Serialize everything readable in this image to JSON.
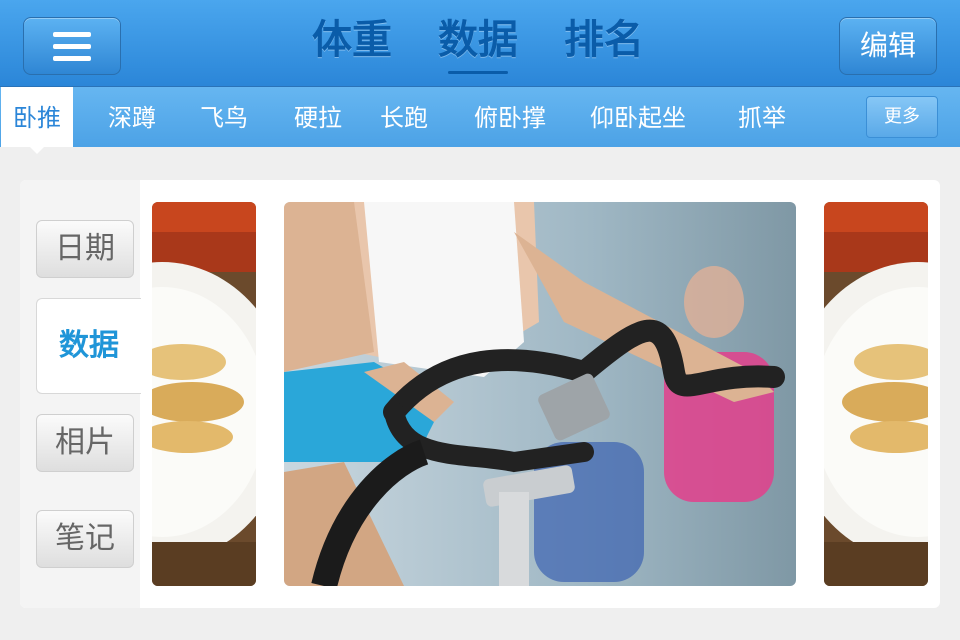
{
  "header": {
    "tabs": [
      {
        "label": "体重"
      },
      {
        "label": "数据"
      },
      {
        "label": "排名"
      }
    ],
    "active_tab_index": 1,
    "edit_label": "编辑"
  },
  "subtabs": {
    "items": [
      {
        "label": "卧推"
      },
      {
        "label": "深蹲"
      },
      {
        "label": "飞鸟"
      },
      {
        "label": "硬拉"
      },
      {
        "label": "长跑"
      },
      {
        "label": "俯卧撑"
      },
      {
        "label": "仰卧起坐"
      },
      {
        "label": "抓举"
      }
    ],
    "active_index": 0,
    "more_label": "更多"
  },
  "side_nav": {
    "items": [
      {
        "label": "日期"
      },
      {
        "label": "数据"
      },
      {
        "label": "相片"
      },
      {
        "label": "笔记"
      }
    ],
    "active_index": 1
  },
  "photos": [
    {
      "icon": "food-plate-photo"
    },
    {
      "icon": "cycling-workout-photo"
    },
    {
      "icon": "food-plate-photo"
    }
  ],
  "colors": {
    "header_blue": "#2b86d8",
    "tab_text": "#0a5ca9",
    "active_side": "#1f95d8"
  }
}
